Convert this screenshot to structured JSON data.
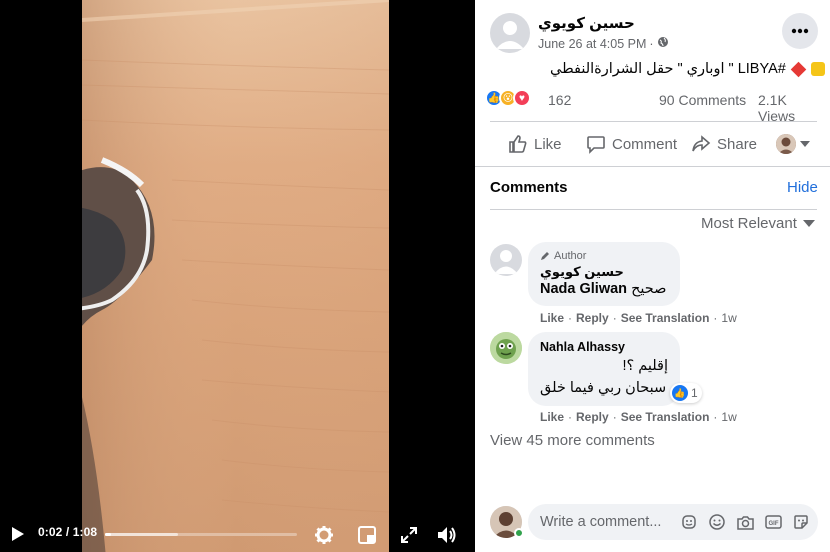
{
  "video": {
    "time_display": "0:02 / 1:08",
    "progress": 0.03,
    "buffered": 0.38
  },
  "post": {
    "author": "حسين كويوي",
    "date": "June 26 at 4:05 PM",
    "dot": "·",
    "text": "اوباري \" حقل الشرارةالنفطي \" LIBYA#",
    "reaction_count": "162",
    "comments_count": "90 Comments",
    "views_count": "2.1K Views"
  },
  "actions": {
    "like": "Like",
    "comment": "Comment",
    "share": "Share"
  },
  "comments_section": {
    "title": "Comments",
    "hide": "Hide",
    "sort": "Most Relevant",
    "view_more": "View 45 more comments",
    "write_placeholder": "Write a comment..."
  },
  "comments": [
    {
      "badge": "Author",
      "name": "حسين كويوي",
      "text_name": "Nada Gliwan",
      "text": "صحيح",
      "like": "Like",
      "reply": "Reply",
      "translate": "See Translation",
      "time": "1w"
    },
    {
      "name": "Nahla Alhassy",
      "line1": "إقليم ؟!",
      "line2": "سبحان ربي فيما خلق",
      "reaction_count": "1",
      "like": "Like",
      "reply": "Reply",
      "translate": "See Translation",
      "time": "1w"
    }
  ],
  "colors": {
    "link": "#216fdb",
    "like_blue": "#1877f2",
    "love_red": "#f33e58",
    "wow_yellow": "#f7b125",
    "online": "#31a24c"
  }
}
